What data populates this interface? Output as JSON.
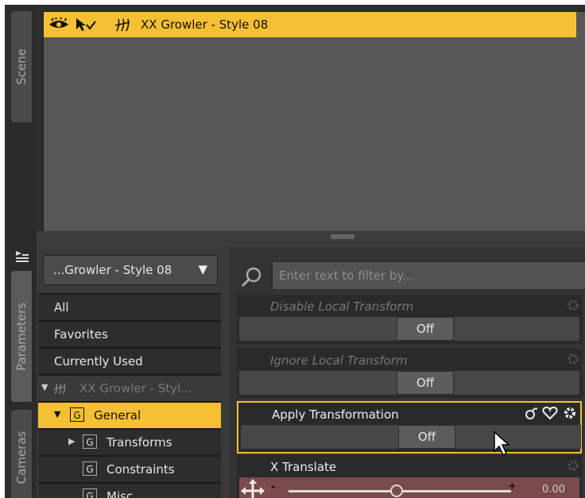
{
  "tabs": {
    "scene": "Scene",
    "parameters": "Parameters",
    "cameras": "Cameras"
  },
  "scene": {
    "item_label": "XX Growler - Style 08",
    "icons": [
      "eye-icon",
      "select-icon",
      "figure-icon"
    ]
  },
  "params": {
    "dropdown_value": "...Growler - Style 08",
    "filter_placeholder": "Enter text to filter by...",
    "list": [
      {
        "label": "All"
      },
      {
        "label": "Favorites"
      },
      {
        "label": "Currently Used"
      },
      {
        "label": "XX Growler - Styl..."
      },
      {
        "label": "General",
        "selected": true
      },
      {
        "label": "Transforms"
      },
      {
        "label": "Constraints"
      },
      {
        "label": "Misc"
      }
    ],
    "props": [
      {
        "name": "Disable Local Transform",
        "value": "Off"
      },
      {
        "name": "Ignore Local Transform",
        "value": "Off"
      },
      {
        "name": "Apply Transformation",
        "value": "Off"
      },
      {
        "name": "X Translate",
        "slider_value": "0.00"
      }
    ],
    "g_letter": "G"
  },
  "colors": {
    "accent": "#f5c033"
  }
}
